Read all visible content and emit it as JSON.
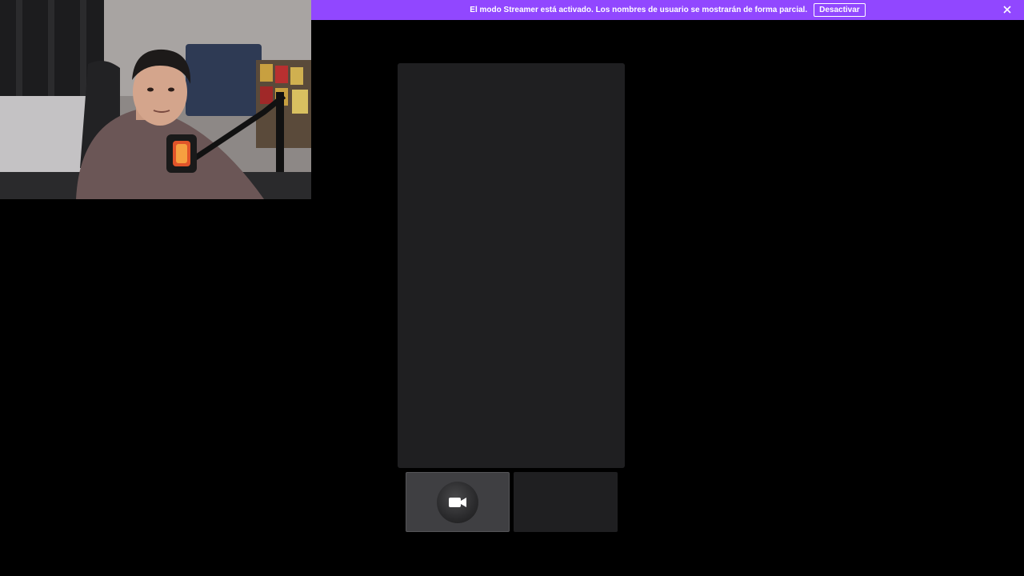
{
  "banner": {
    "message": "El modo Streamer está activado. Los nombres de usuario se mostrarán de forma parcial.",
    "button_label": "Desactivar",
    "close_icon": "close-icon",
    "background_color": "#9147ff"
  },
  "webcam": {
    "content": "webcam-feed"
  },
  "main_panel": {
    "background_color": "#1f1f21"
  },
  "thumbnails": [
    {
      "icon": "video-camera-icon",
      "background_color": "#3f3f42"
    },
    {
      "background_color": "#1f1f21"
    }
  ]
}
